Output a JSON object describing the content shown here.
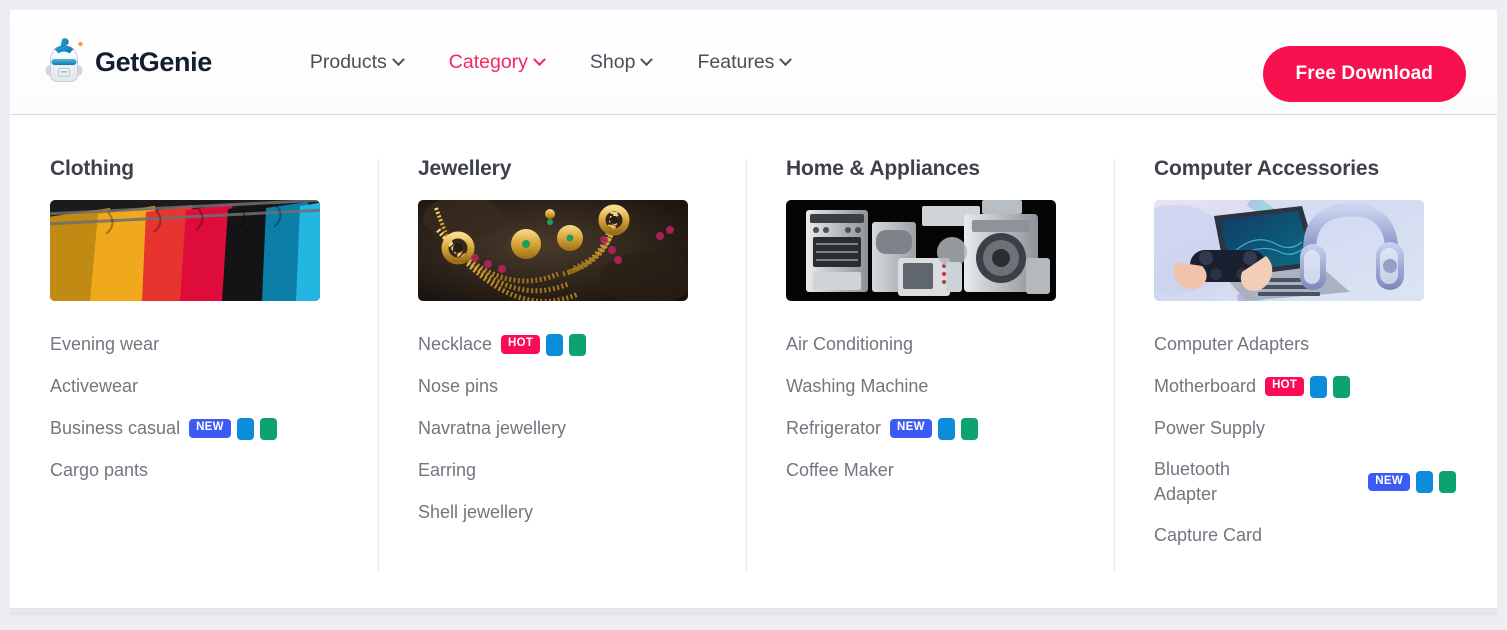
{
  "header": {
    "brand": {
      "name": "GetGenie",
      "logo_icon": "genie-robot-logo"
    },
    "nav": [
      {
        "label": "Products",
        "active": false,
        "icon": "chevron-down-icon"
      },
      {
        "label": "Category",
        "active": true,
        "icon": "chevron-down-icon"
      },
      {
        "label": "Shop",
        "active": false,
        "icon": "chevron-down-icon"
      },
      {
        "label": "Features",
        "active": false,
        "icon": "chevron-down-icon"
      }
    ],
    "cta_label": "Free Download"
  },
  "colors": {
    "accent_pink": "#f8104f",
    "active_nav": "#f6275e",
    "badge_new": "#3c5bf5",
    "badge_hot": "#fa0c56",
    "chip_blue": "#0b8ddb",
    "chip_green": "#0ca272",
    "text_muted": "#71767f",
    "heading": "#3d4149",
    "page_bg": "#eceef2",
    "divider": "#e6e8ec"
  },
  "mega_menu": {
    "columns": [
      {
        "title": "Clothing",
        "image_alt": "colorful-sweaters-on-hangers",
        "links": [
          {
            "label": "Evening wear",
            "badges": []
          },
          {
            "label": "Activewear",
            "badges": []
          },
          {
            "label": "Business casual",
            "badges": [
              "NEW",
              "blue-chip",
              "green-chip"
            ]
          },
          {
            "label": "Cargo pants",
            "badges": []
          }
        ]
      },
      {
        "title": "Jewellery",
        "image_alt": "gold-necklace-and-earrings",
        "links": [
          {
            "label": "Necklace",
            "badges": [
              "HOT",
              "blue-chip",
              "green-chip"
            ]
          },
          {
            "label": "Nose pins",
            "badges": []
          },
          {
            "label": "Navratna jewellery",
            "badges": []
          },
          {
            "label": "Earring",
            "badges": []
          },
          {
            "label": "Shell jewellery",
            "badges": []
          }
        ]
      },
      {
        "title": "Home & Appliances",
        "image_alt": "kitchen-appliances-group",
        "links": [
          {
            "label": "Air Conditioning",
            "badges": []
          },
          {
            "label": "Washing Machine",
            "badges": []
          },
          {
            "label": "Refrigerator",
            "badges": [
              "NEW",
              "blue-chip",
              "green-chip"
            ]
          },
          {
            "label": "Coffee Maker",
            "badges": []
          }
        ]
      },
      {
        "title": "Computer Accessories",
        "image_alt": "gamepad-laptop-and-headphones",
        "links": [
          {
            "label": "Computer Adapters",
            "badges": []
          },
          {
            "label": "Motherboard",
            "badges": [
              "HOT",
              "blue-chip",
              "green-chip"
            ]
          },
          {
            "label": "Power Supply",
            "badges": []
          },
          {
            "label": "Bluetooth Adapter",
            "badges": [
              "NEW",
              "blue-chip",
              "green-chip"
            ],
            "wraps": true
          },
          {
            "label": "Capture Card",
            "badges": []
          }
        ]
      }
    ]
  }
}
